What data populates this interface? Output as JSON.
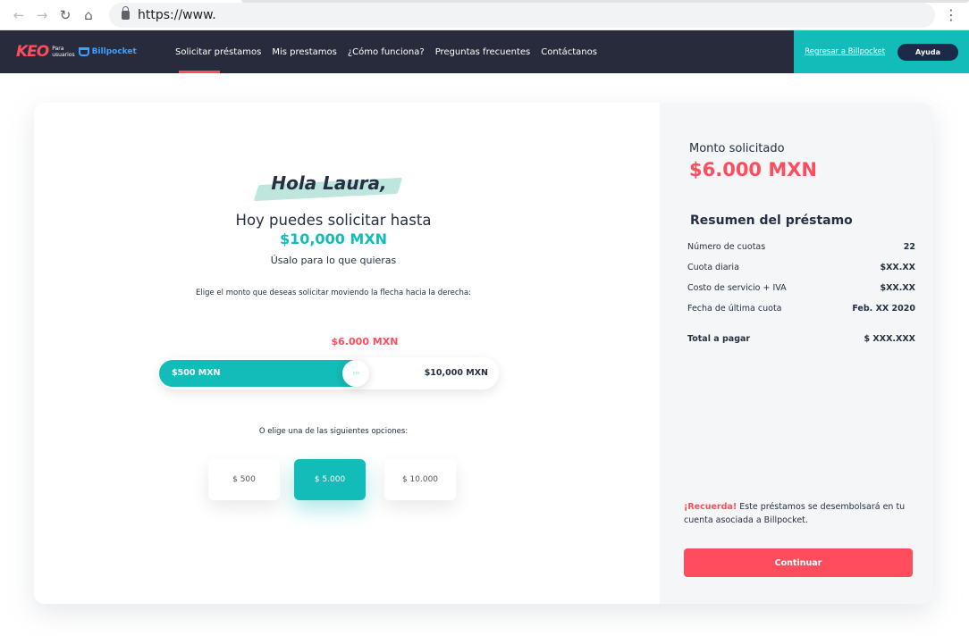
{
  "browser": {
    "url": "https://www.",
    "icons": {
      "back": "arrow-left-icon",
      "forward": "arrow-right-icon",
      "reload": "reload-icon",
      "home": "home-icon",
      "lock": "lock-icon",
      "menu": "kebab-menu-icon"
    }
  },
  "nav": {
    "brand": {
      "keo": "KEO",
      "para": "Para",
      "usuarios": "usuarios",
      "billpocket": "Billpocket"
    },
    "items": [
      {
        "label": "Solicitar préstamos",
        "active": true
      },
      {
        "label": "Mis prestamos",
        "active": false
      },
      {
        "label": "¿Cómo funciona?",
        "active": false
      },
      {
        "label": "Preguntas frecuentes",
        "active": false
      },
      {
        "label": "Contáctanos",
        "active": false
      }
    ],
    "back_link": "Regresar a Billpocket",
    "help": "Ayuda"
  },
  "main": {
    "greeting": "Hola Laura,",
    "headline": "Hoy puedes solicitar hasta",
    "max_amount": "$10,000 MXN",
    "subtitle": "Úsalo para lo que quieras",
    "instruction": "Elige el monto que deseas solicitar moviendo la flecha hacia la derecha:",
    "selected_amount": "$6.000 MXN",
    "slider": {
      "min_label": "$500 MXN",
      "max_label": "$10,000 MXN",
      "fraction": 0.58,
      "thumb_glyph": "›››"
    },
    "options_text": "O elige una de las siguientes opciones:",
    "options": [
      {
        "label": "$ 500",
        "selected": false
      },
      {
        "label": "$ 5.000",
        "selected": true
      },
      {
        "label": "$ 10.000",
        "selected": false
      }
    ]
  },
  "summary": {
    "requested_label": "Monto solicitado",
    "requested_amount": "$6.000 MXN",
    "title": "Resumen del préstamo",
    "rows": [
      {
        "label": "Número de cuotas",
        "value": "22"
      },
      {
        "label": "Cuota diaria",
        "value": "$XX.XX"
      },
      {
        "label": "Costo de servicio + IVA",
        "value": "$XX.XX"
      },
      {
        "label": "Fecha de última cuota",
        "value": "Feb. XX 2020"
      }
    ],
    "total": {
      "label": "Total a pagar",
      "value": "$ XXX.XXX"
    },
    "reminder_highlight": "¡Recuerda!",
    "reminder_text": " Este préstamos se desembolsará en tu cuenta asociada a Billpocket.",
    "continue": "Continuar"
  },
  "colors": {
    "accent": "#12bcb8",
    "brand_red": "#ff4d5e",
    "navbar": "#282b3b",
    "text": "#253042"
  }
}
